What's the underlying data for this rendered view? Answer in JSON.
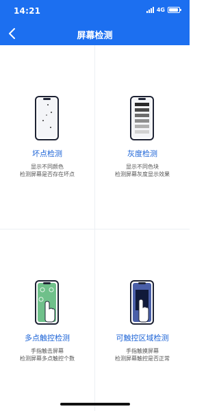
{
  "status_bar": {
    "time": "14:21",
    "network": "4G"
  },
  "nav": {
    "title": "屏幕检测",
    "back_icon": "chevron-left-icon"
  },
  "colors": {
    "brand": "#1c6ff0",
    "tile_title": "#1a62d6",
    "tile_desc": "#555555",
    "divider": "#eceff3"
  },
  "tiles": [
    {
      "title": "坏点检测",
      "desc_line1": "显示不同颜色",
      "desc_line2": "检测屏幕是否存在坏点",
      "icon": "phone-dead-pixel-icon"
    },
    {
      "title": "灰度检测",
      "desc_line1": "显示不同色块",
      "desc_line2": "检测屏幕灰度显示效果",
      "icon": "phone-grayscale-icon"
    },
    {
      "title": "多点触控检测",
      "desc_line1": "手指触击屏幕",
      "desc_line2": "检测屏幕多点触控个数",
      "icon": "phone-multitouch-icon"
    },
    {
      "title": "可触控区域检测",
      "desc_line1": "手指触摸屏幕",
      "desc_line2": "检测屏幕触控是否正常",
      "icon": "phone-touch-area-icon"
    }
  ]
}
